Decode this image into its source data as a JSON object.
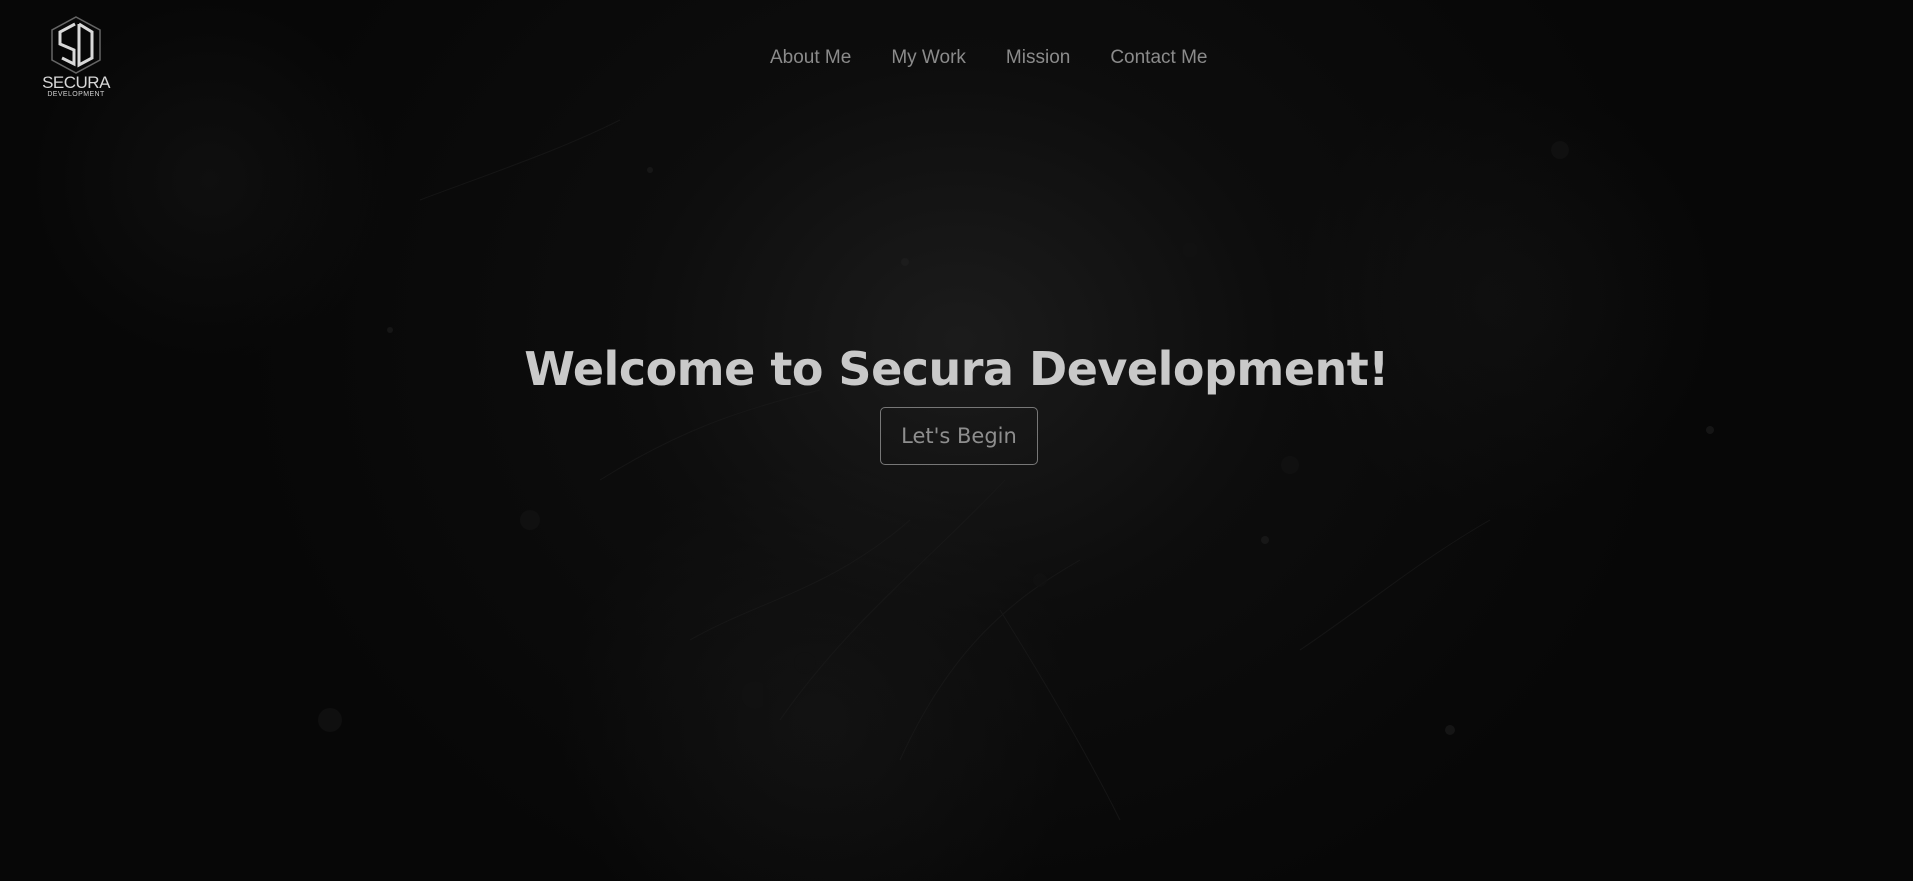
{
  "brand": {
    "name": "SECURA",
    "subtitle": "DEVELOPMENT",
    "icon": "sd-cube-logo"
  },
  "nav": {
    "items": [
      {
        "label": "About Me"
      },
      {
        "label": "My Work"
      },
      {
        "label": "Mission"
      },
      {
        "label": "Contact Me"
      }
    ]
  },
  "hero": {
    "title": "Welcome to Secura Development!",
    "button_label": "Let's Begin"
  },
  "colors": {
    "background": "#070707",
    "nav_text": "#8b8b8b",
    "title_text": "#c9c9c9",
    "button_border": "#777777"
  }
}
